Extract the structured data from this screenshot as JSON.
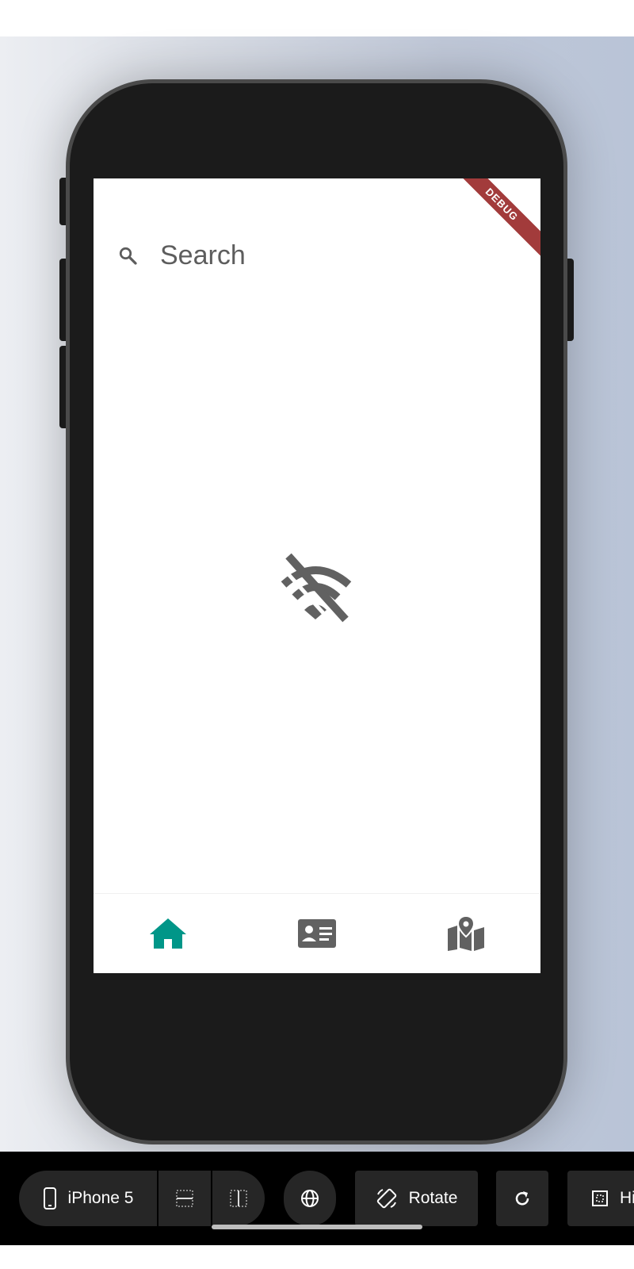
{
  "app": {
    "search_placeholder": "Search",
    "debug_banner": "DEBUG",
    "status_icon": "wifi-off-icon",
    "accent_color": "#009688",
    "icon_color": "#616161"
  },
  "bottom_nav": {
    "items": [
      {
        "icon": "home-icon",
        "active": true
      },
      {
        "icon": "contact-card-icon",
        "active": false
      },
      {
        "icon": "map-icon",
        "active": false
      }
    ]
  },
  "toolbar": {
    "device_label": "iPhone 5",
    "rotate_label": "Rotate",
    "hide_label": "Hi",
    "icons": [
      "phone-icon",
      "horizontal-guides-icon",
      "vertical-guides-icon",
      "globe-icon",
      "rotate-icon",
      "refresh-icon",
      "hide-icon"
    ]
  }
}
